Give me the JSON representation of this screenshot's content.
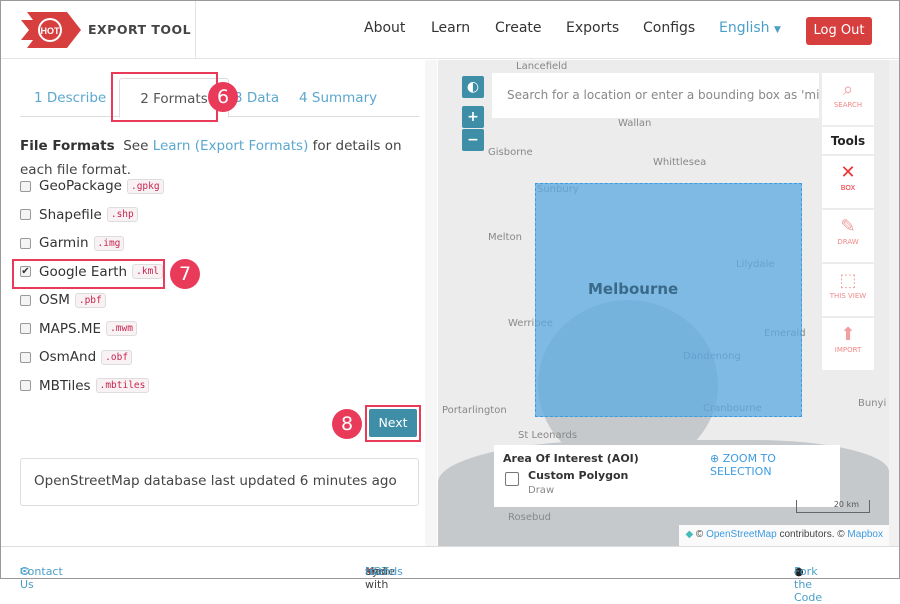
{
  "header": {
    "logo_badge": "HOT",
    "logo_text": "EXPORT TOOL",
    "nav": [
      "About",
      "Learn",
      "Create",
      "Exports",
      "Configs"
    ],
    "language": "English",
    "logout": "Log Out"
  },
  "tabs": [
    "1 Describe",
    "2 Formats",
    "3 Data",
    "4 Summary"
  ],
  "annotations": [
    "6",
    "7",
    "8"
  ],
  "file_formats": {
    "title": "File Formats",
    "pre": "See",
    "link": "Learn (Export Formats)",
    "post": "for details on each file format.",
    "items": [
      {
        "label": "GeoPackage",
        "ext": ".gpkg",
        "checked": false
      },
      {
        "label": "Shapefile",
        "ext": ".shp",
        "checked": false
      },
      {
        "label": "Garmin",
        "ext": ".img",
        "checked": false
      },
      {
        "label": "Google Earth",
        "ext": ".kml",
        "checked": true
      },
      {
        "label": "OSM",
        "ext": ".pbf",
        "checked": false
      },
      {
        "label": "MAPS.ME",
        "ext": ".mwm",
        "checked": false
      },
      {
        "label": "OsmAnd",
        "ext": ".obf",
        "checked": false
      },
      {
        "label": "MBTiles",
        "ext": ".mbtiles",
        "checked": false
      }
    ]
  },
  "next": "Next",
  "status": "OpenStreetMap database last updated 6 minutes ago",
  "map": {
    "search_placeholder": "Search for a location or enter a bounding box as 'min",
    "tools_title": "Tools",
    "tools": [
      "SEARCH",
      "BOX",
      "DRAW",
      "THIS VIEW",
      "IMPORT"
    ],
    "labels": [
      "Lancefield",
      "Wallan",
      "Gisborne",
      "Whittlesea",
      "Sunbury",
      "Melton",
      "Lilydale",
      "Melbourne",
      "Werribee",
      "Emerald",
      "Dandenong",
      "Cranbourne",
      "Portarlington",
      "St Leonards",
      "Rosebud",
      "Bunyi"
    ],
    "aoi_title": "Area Of Interest (AOI)",
    "zoom_to_selection": "ZOOM TO SELECTION",
    "aoi_item": "Custom Polygon",
    "aoi_sub": "Draw",
    "scale": "20 km",
    "attr_osm": "OpenStreetMap",
    "attr_mid": "contributors. ©",
    "attr_mapbox": "Mapbox",
    "attr_copy": "©"
  },
  "footer": {
    "contact": "Contact Us",
    "made_with": "Made with",
    "by": "by",
    "hot": "HOT",
    "and": "and",
    "friends": "friends",
    "fork": "Fork the Code"
  }
}
